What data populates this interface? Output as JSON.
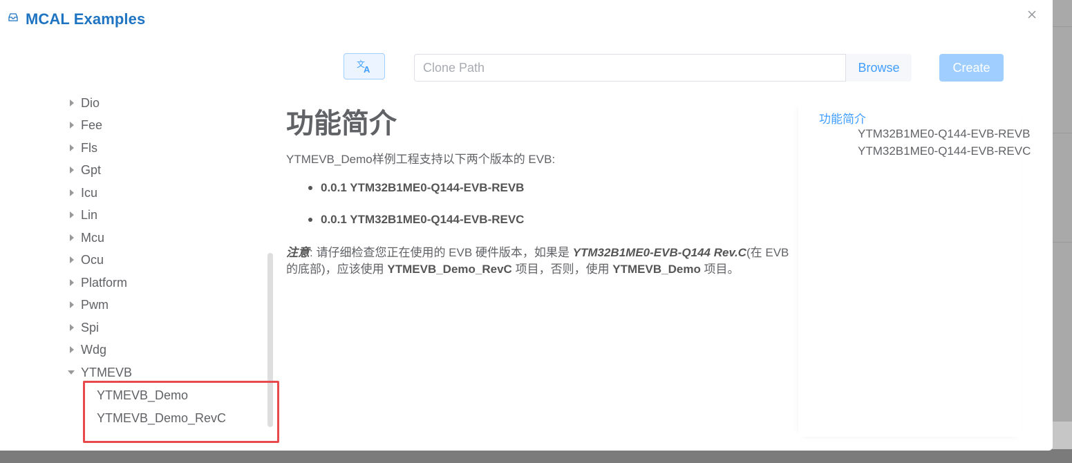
{
  "dialog": {
    "title": "MCAL Examples",
    "icons": {
      "title": "tray-icon",
      "close": "close-icon",
      "translate": "translate-icon"
    }
  },
  "toolbar": {
    "clone_path_placeholder": "Clone Path",
    "clone_path_value": "",
    "browse_label": "Browse",
    "create_label": "Create"
  },
  "tree": {
    "items": [
      {
        "label": "Dio"
      },
      {
        "label": "Fee"
      },
      {
        "label": "Fls"
      },
      {
        "label": "Gpt"
      },
      {
        "label": "Icu"
      },
      {
        "label": "Lin"
      },
      {
        "label": "Mcu"
      },
      {
        "label": "Ocu"
      },
      {
        "label": "Platform"
      },
      {
        "label": "Pwm"
      },
      {
        "label": "Spi"
      },
      {
        "label": "Wdg"
      },
      {
        "label": "YTMEVB",
        "expanded": true
      }
    ],
    "children": [
      {
        "label": "YTMEVB_Demo"
      },
      {
        "label": "YTMEVB_Demo_RevC"
      }
    ]
  },
  "content": {
    "heading": "功能简介",
    "intro": "YTMEVB_Demo样例工程支持以下两个版本的 EVB:",
    "bullets": [
      "0.0.1 YTM32B1ME0-Q144-EVB-REVB",
      "0.0.1 YTM32B1ME0-Q144-EVB-REVC"
    ],
    "note": {
      "label": "注意",
      "t1": ": 请仔细检查您正在使用的 EVB 硬件版本，如果是 ",
      "board": "YTM32B1ME0-EVB-Q144 Rev.C",
      "t2": "(在 EVB 的底部)，应该使用 ",
      "proj_revc": "YTMEVB_Demo_RevC",
      "t3": " 项目，否则，使用 ",
      "proj": "YTMEVB_Demo",
      "t4": " 项目。"
    }
  },
  "toc": {
    "title": "功能简介",
    "items": [
      "YTM32B1ME0-Q144-EVB-REVB",
      "YTM32B1ME0-Q144-EVB-REVC"
    ]
  },
  "colors": {
    "title": "#1f74c2",
    "accent": "#409eff",
    "create_disabled": "#a0cfff",
    "highlight": "#e8494c"
  }
}
